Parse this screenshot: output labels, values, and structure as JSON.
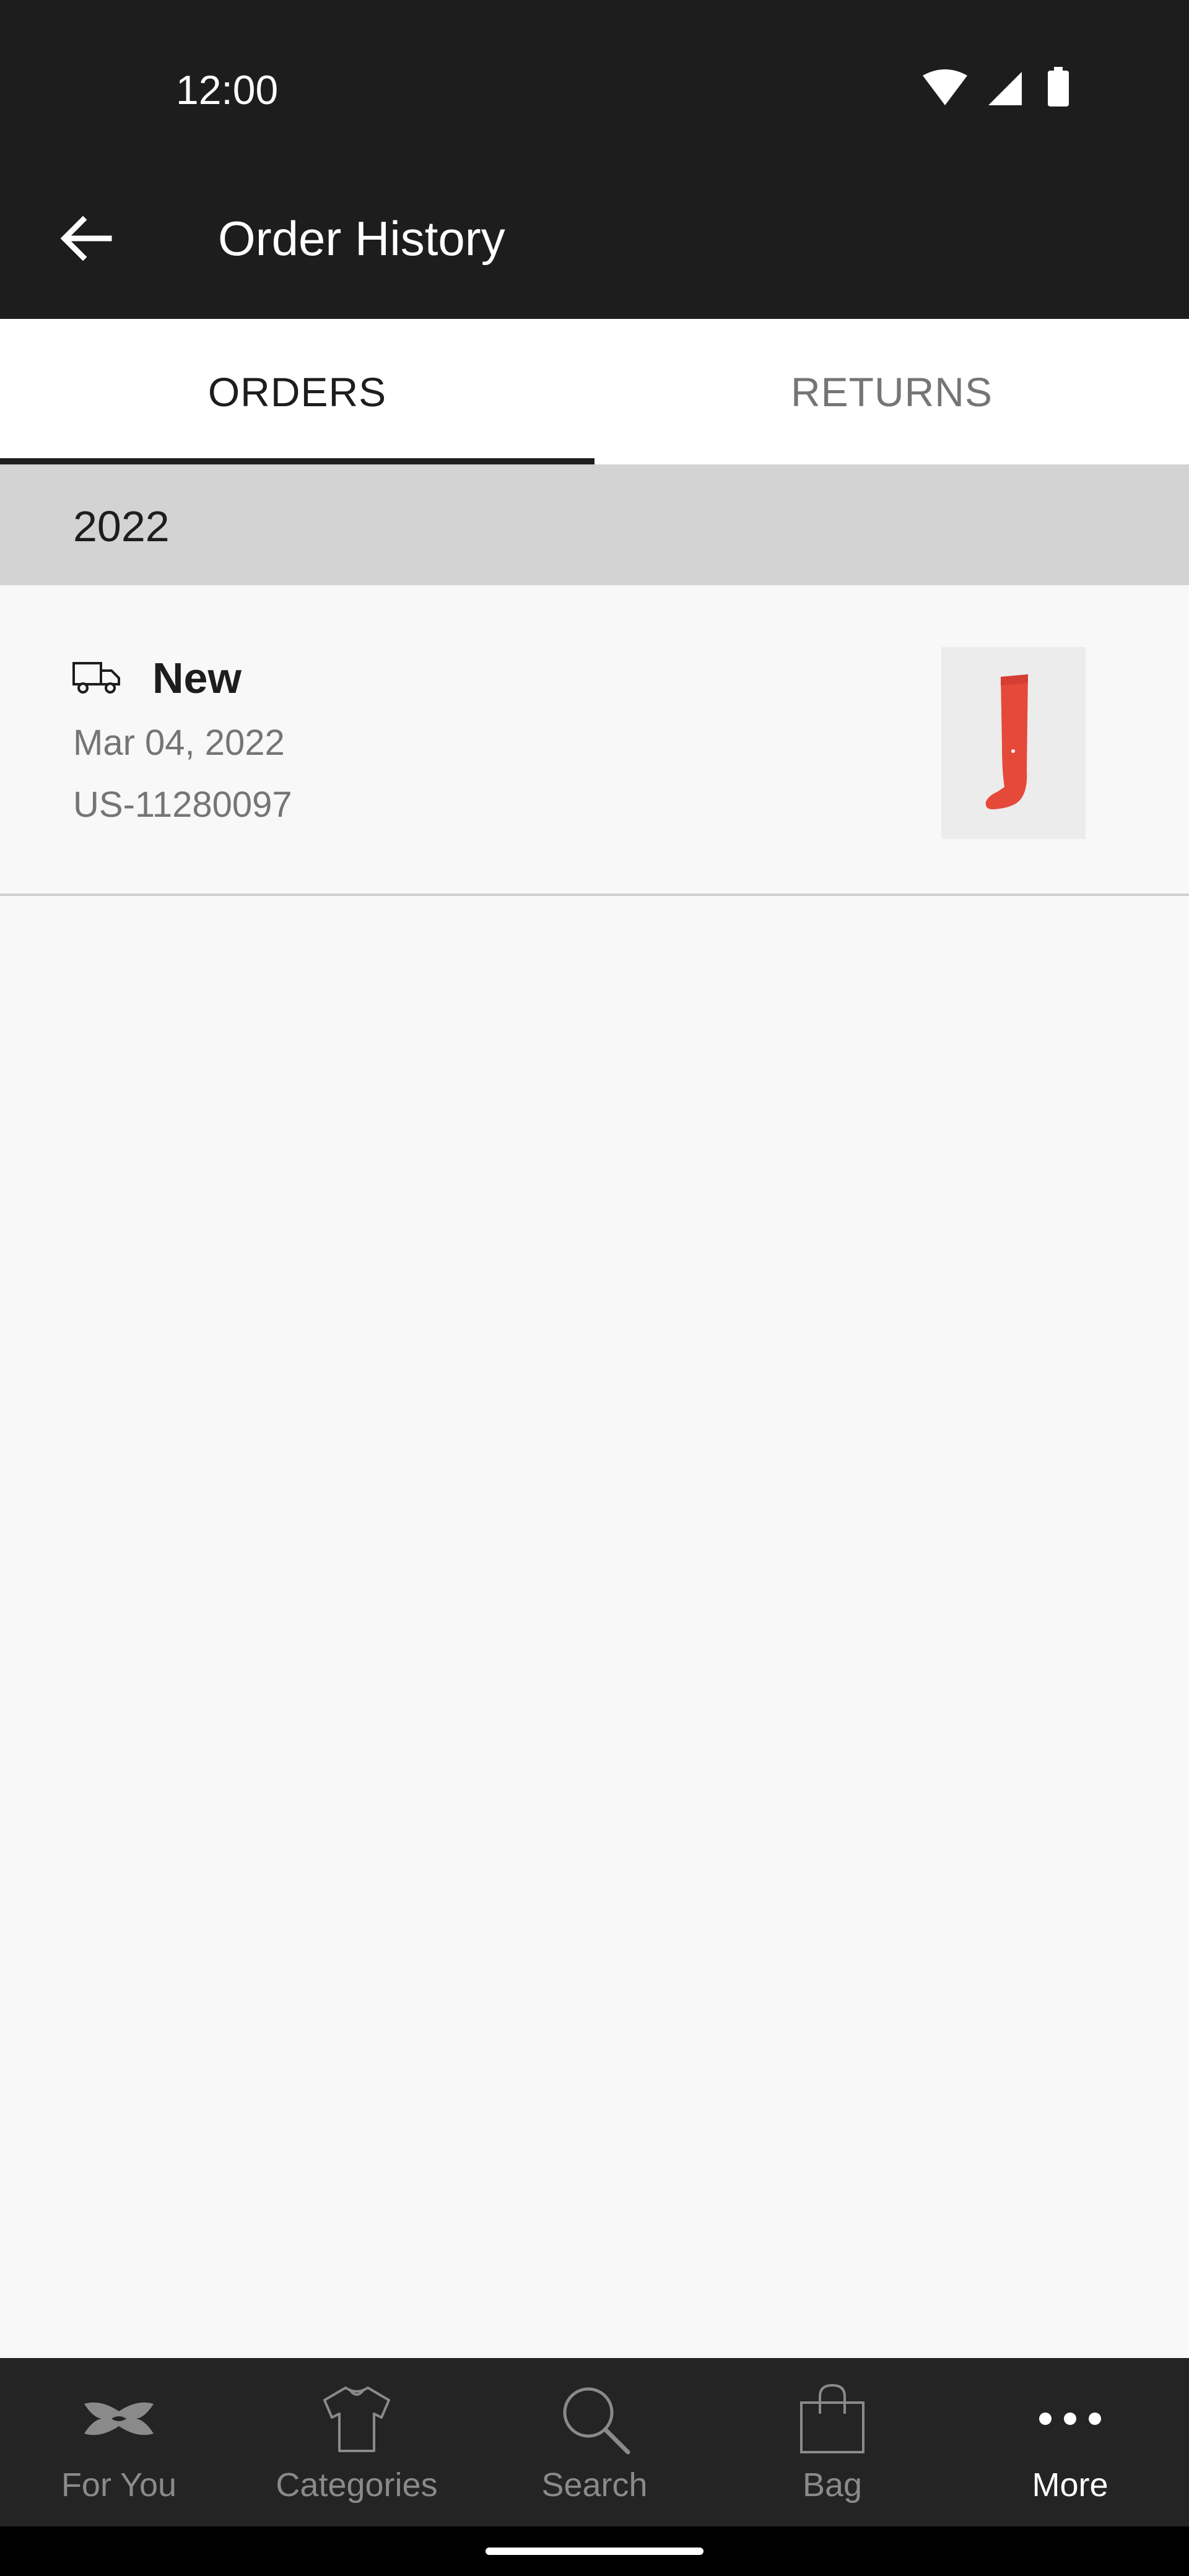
{
  "status_bar": {
    "time": "12:00"
  },
  "app_bar": {
    "title": "Order History"
  },
  "tabs": [
    {
      "label": "ORDERS",
      "selected": true
    },
    {
      "label": "RETURNS",
      "selected": false
    }
  ],
  "orders": {
    "year": "2022",
    "items": [
      {
        "status": "New",
        "date": "Mar 04, 2022",
        "order_number": "US-11280097",
        "product_color": "#e5493a"
      }
    ]
  },
  "bottom_nav": {
    "items": [
      {
        "label": "For You",
        "icon": "brand-logo-icon"
      },
      {
        "label": "Categories",
        "icon": "shirt-icon"
      },
      {
        "label": "Search",
        "icon": "search-icon"
      },
      {
        "label": "Bag",
        "icon": "bag-icon"
      },
      {
        "label": "More",
        "icon": "more-icon",
        "active": true
      }
    ]
  },
  "colors": {
    "bar_dark": "#1d1d1d",
    "nav_dark": "#242424",
    "year_header": "#d3d3d3",
    "muted_text": "#757575"
  }
}
